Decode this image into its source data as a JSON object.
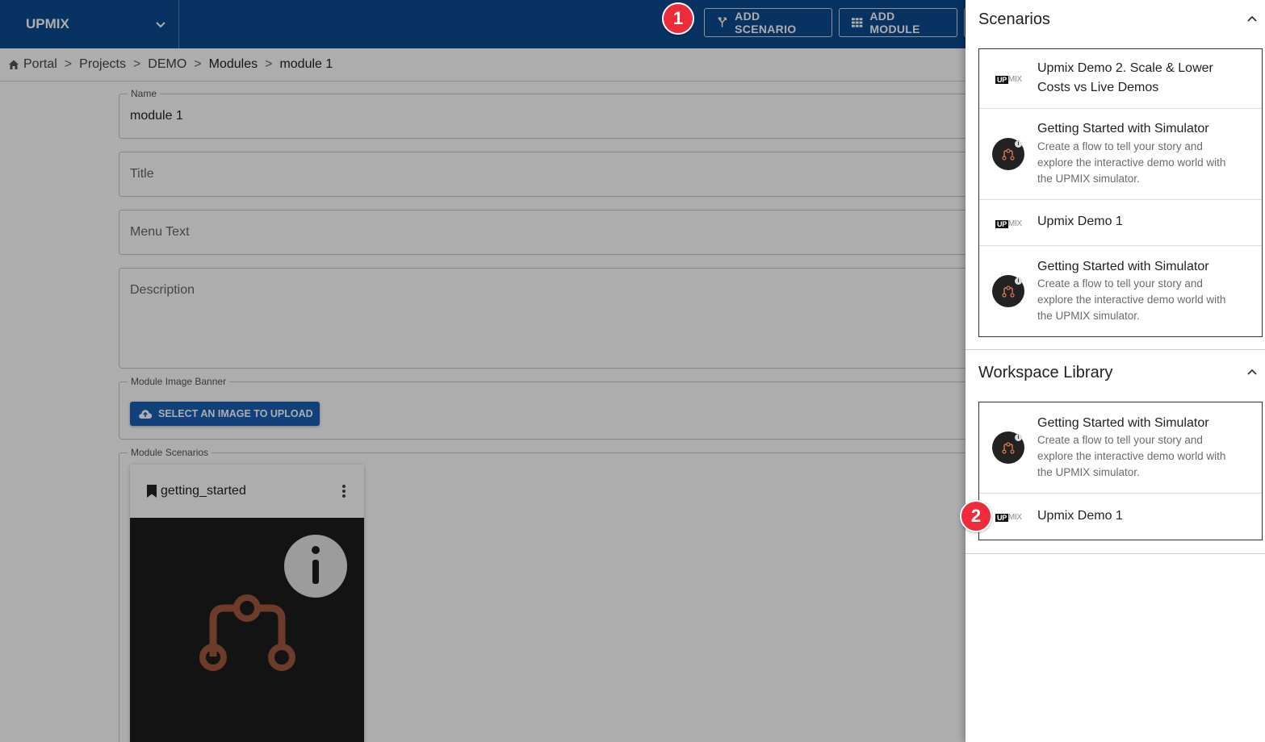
{
  "app": {
    "brand": "UPMIX"
  },
  "toolbar": {
    "add_scenario_label": "ADD SCENARIO",
    "add_module_label": "ADD MODULE"
  },
  "breadcrumb": {
    "items": [
      "Portal",
      "Projects",
      "DEMO",
      "Modules",
      "module 1"
    ],
    "separator": ">"
  },
  "form": {
    "name": {
      "legend": "Name",
      "value": "module 1"
    },
    "title": {
      "placeholder": "Title"
    },
    "menu_text": {
      "placeholder": "Menu Text"
    },
    "description": {
      "placeholder": "Description"
    },
    "banner": {
      "legend": "Module Image Banner",
      "upload_label": "SELECT AN IMAGE TO UPLOAD"
    },
    "scenarios": {
      "legend": "Module Scenarios",
      "card_title": "getting_started"
    }
  },
  "panel": {
    "scenarios": {
      "title": "Scenarios",
      "items": [
        {
          "title_line1": "Upmix Demo 2. Scale & Lower",
          "title_line2": "Costs vs Live Demos",
          "icon": "upmix-logo"
        },
        {
          "title": "Getting Started with Simulator",
          "desc_line1": "Create a flow to tell your story and",
          "desc_line2": "explore the interactive demo world with",
          "desc_line3": "the UPMIX simulator.",
          "icon": "simulator-icon"
        },
        {
          "title": "Upmix Demo 1",
          "icon": "upmix-logo"
        },
        {
          "title": "Getting Started with Simulator",
          "desc_line1": "Create a flow to tell your story and",
          "desc_line2": "explore the interactive demo world with",
          "desc_line3": "the UPMIX simulator.",
          "icon": "simulator-icon"
        }
      ]
    },
    "library": {
      "title": "Workspace Library",
      "items": [
        {
          "title": "Getting Started with Simulator",
          "desc_line1": "Create a flow to tell your story and",
          "desc_line2": "explore the interactive demo world with",
          "desc_line3": "the UPMIX simulator.",
          "icon": "simulator-icon"
        },
        {
          "title": "Upmix Demo 1",
          "icon": "upmix-logo"
        }
      ]
    }
  },
  "logo": {
    "part1": "UP",
    "part2": "MIX"
  },
  "annotations": {
    "badge1": "1",
    "badge2": "2"
  },
  "colors": {
    "header": "#0d4a8f",
    "primary_button": "#1a5fb4",
    "badge": "#ee2b3b",
    "simulator_accent": "#a0573e"
  }
}
